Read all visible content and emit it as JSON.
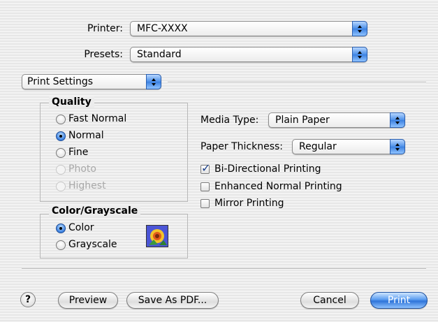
{
  "printer": {
    "label": "Printer:",
    "value": "MFC-XXXX"
  },
  "presets": {
    "label": "Presets:",
    "value": "Standard"
  },
  "panel_menu": {
    "value": "Print Settings"
  },
  "quality": {
    "title": "Quality",
    "options": [
      {
        "label": "Fast Normal",
        "selected": false,
        "enabled": true
      },
      {
        "label": "Normal",
        "selected": true,
        "enabled": true
      },
      {
        "label": "Fine",
        "selected": false,
        "enabled": true
      },
      {
        "label": "Photo",
        "selected": false,
        "enabled": false
      },
      {
        "label": "Highest",
        "selected": false,
        "enabled": false
      }
    ]
  },
  "color_grayscale": {
    "title": "Color/Grayscale",
    "options": [
      {
        "label": "Color",
        "selected": true
      },
      {
        "label": "Grayscale",
        "selected": false
      }
    ],
    "icon": "color-image-icon"
  },
  "media_type": {
    "label": "Media Type:",
    "value": "Plain Paper"
  },
  "paper_thickness": {
    "label": "Paper Thickness:",
    "value": "Regular"
  },
  "options": [
    {
      "label": "Bi-Directional Printing",
      "checked": true
    },
    {
      "label": "Enhanced Normal Printing",
      "checked": false
    },
    {
      "label": "Mirror Printing",
      "checked": false
    }
  ],
  "buttons": {
    "help": "?",
    "preview": "Preview",
    "save_pdf": "Save As PDF...",
    "cancel": "Cancel",
    "print": "Print"
  },
  "colors": {
    "accent": "#3b80e0",
    "background": "#ececec"
  }
}
